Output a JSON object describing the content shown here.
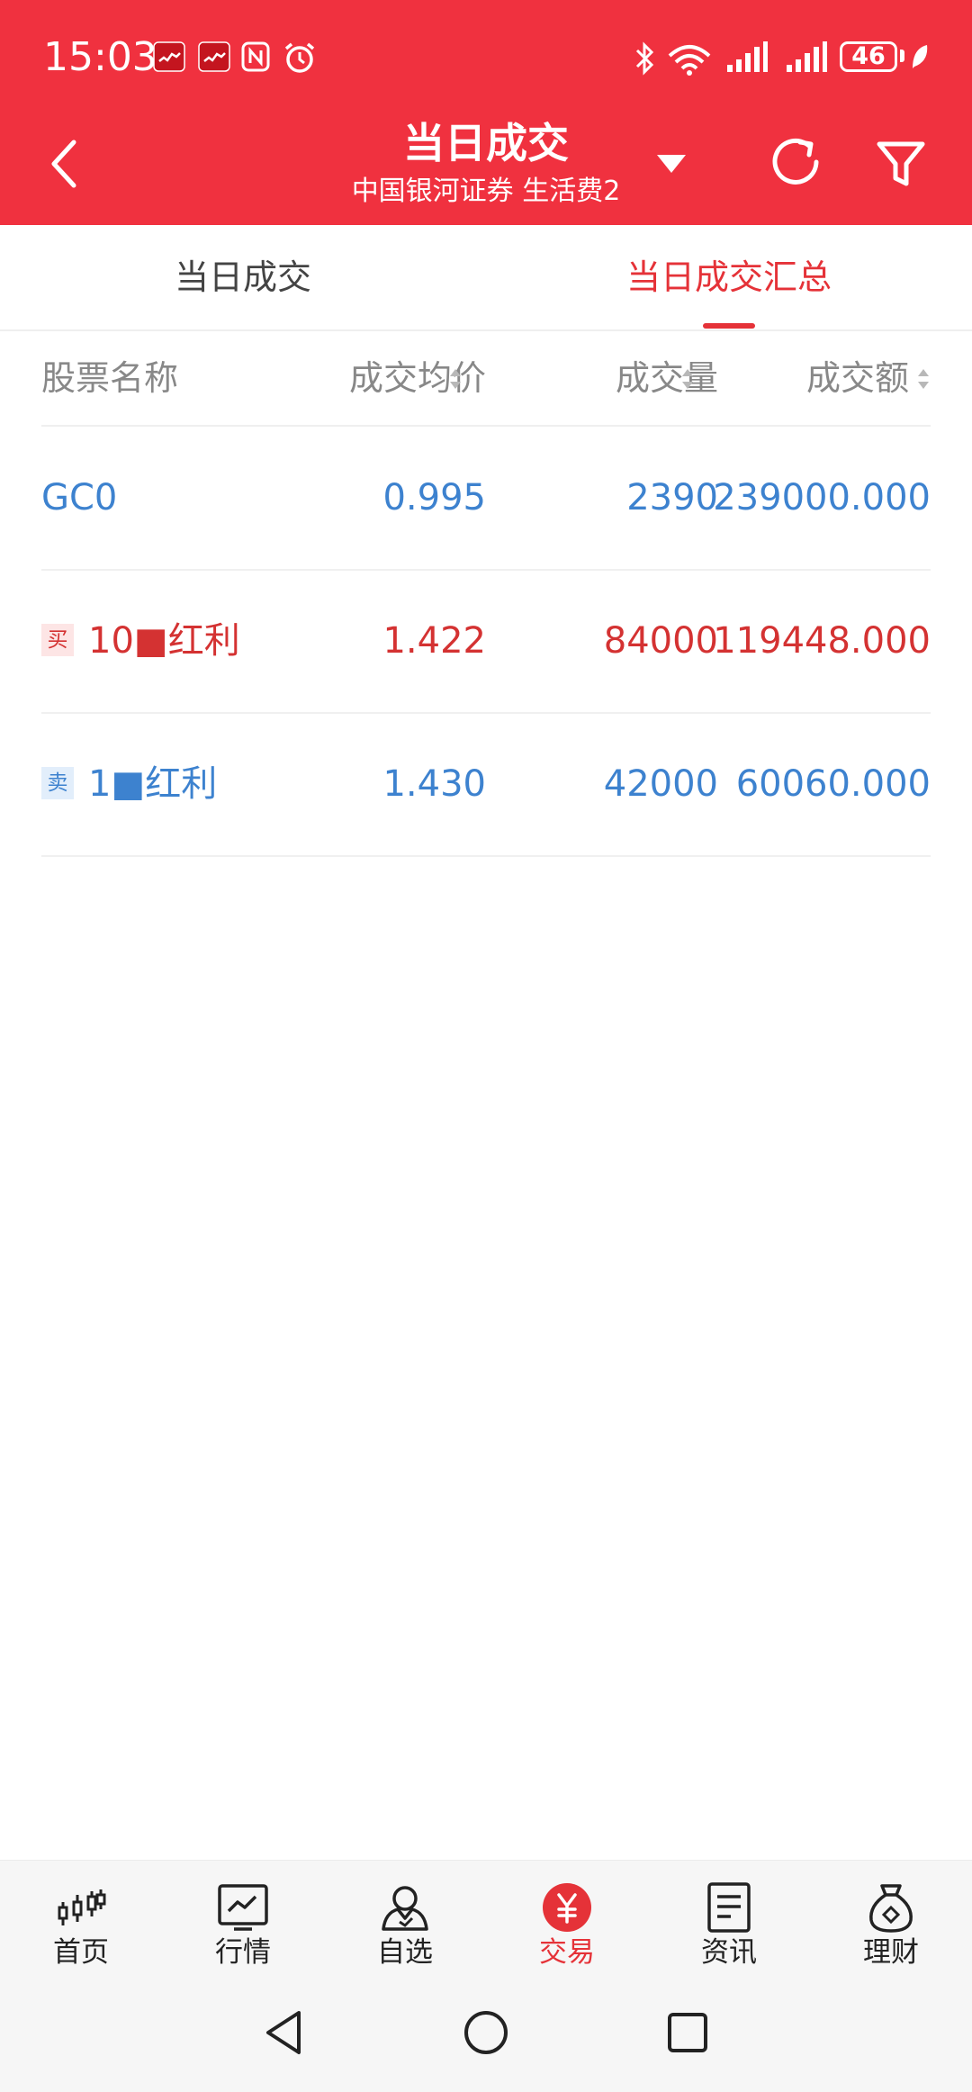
{
  "status_bar": {
    "time": "15:03",
    "battery": "46",
    "icons": [
      "notification-icon",
      "notification-icon",
      "nfc-icon",
      "alarm-icon",
      "bluetooth-icon",
      "wifi-icon",
      "signal-icon",
      "signal-icon",
      "leaf-icon"
    ]
  },
  "header": {
    "title": "当日成交",
    "subtitle": "中国银河证券 生活费2",
    "background_color": "#f0313f"
  },
  "tabs": [
    {
      "label": "当日成交",
      "active": false
    },
    {
      "label": "当日成交汇总",
      "active": true
    }
  ],
  "table": {
    "columns": [
      "股票名称",
      "成交均价",
      "成交量",
      "成交额"
    ],
    "rows": [
      {
        "name": "GC0",
        "badge": "",
        "avg_price": "0.995",
        "volume": "2390",
        "amount": "239000.000",
        "color": "#3d82cf"
      },
      {
        "name": "10■红利",
        "badge": "买",
        "avg_price": "1.422",
        "volume": "84000",
        "amount": "119448.000",
        "color": "#d43232"
      },
      {
        "name": "1■红利",
        "badge": "卖",
        "avg_price": "1.430",
        "volume": "42000",
        "amount": "60060.000",
        "color": "#3d82cf"
      }
    ]
  },
  "bottom_nav": [
    {
      "label": "首页",
      "icon": "candlestick-icon"
    },
    {
      "label": "行情",
      "icon": "chart-icon"
    },
    {
      "label": "自选",
      "icon": "user-icon"
    },
    {
      "label": "交易",
      "icon": "yen-icon",
      "active": true
    },
    {
      "label": "资讯",
      "icon": "document-icon"
    },
    {
      "label": "理财",
      "icon": "money-bag-icon"
    }
  ],
  "colors": {
    "accent": "#e53238",
    "up": "#d43232",
    "down": "#3d82cf"
  }
}
